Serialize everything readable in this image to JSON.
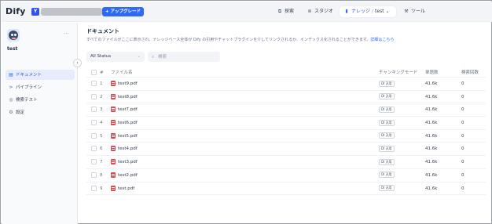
{
  "header": {
    "logo": "Dify",
    "workspace_initial": "Y",
    "upgrade_label": "+ アップグレード",
    "nav": {
      "explore": "探索",
      "studio": "スタジオ",
      "knowledge": "ナレッジ",
      "dataset_name": "test",
      "tools": "ツール"
    }
  },
  "sidebar": {
    "dataset_title": "test",
    "more": "···",
    "collapse": "‹",
    "items": [
      {
        "label": "ドキュメント",
        "icon": "document-icon",
        "active": true
      },
      {
        "label": "パイプライン",
        "icon": "pipeline-icon",
        "active": false
      },
      {
        "label": "検索テスト",
        "icon": "target-icon",
        "active": false
      },
      {
        "label": "設定",
        "icon": "settings-icon",
        "active": false
      }
    ]
  },
  "main": {
    "title": "ドキュメント",
    "description": "すべてのファイルがここに表示され、ナレッジベース全体が Dify の引用やチャットプラグインを介してリンクされるか、インデックス化されることができます。",
    "description_link": "詳細はこちら",
    "status_select": "All Status",
    "search_placeholder": "検索",
    "columns": {
      "num": "#",
      "name": "ファイル名",
      "mode": "チャンキングモード",
      "words": "単語数",
      "hits": "検索回数"
    },
    "rows": [
      {
        "num": "1",
        "name": "test9.pdf",
        "mode": "DI 汎用",
        "words": "41.6k",
        "hits": "0"
      },
      {
        "num": "2",
        "name": "test8.pdf",
        "mode": "DI 汎用",
        "words": "41.6k",
        "hits": "0"
      },
      {
        "num": "3",
        "name": "test7.pdf",
        "mode": "DI 汎用",
        "words": "41.6k",
        "hits": "0"
      },
      {
        "num": "4",
        "name": "test6.pdf",
        "mode": "DI 汎用",
        "words": "41.6k",
        "hits": "0"
      },
      {
        "num": "5",
        "name": "test5.pdf",
        "mode": "DI 汎用",
        "words": "41.6k",
        "hits": "0"
      },
      {
        "num": "6",
        "name": "test4.pdf",
        "mode": "DI 汎用",
        "words": "41.6k",
        "hits": "0"
      },
      {
        "num": "7",
        "name": "test3.pdf",
        "mode": "DI 汎用",
        "words": "41.6k",
        "hits": "0"
      },
      {
        "num": "8",
        "name": "test2.pdf",
        "mode": "DI 汎用",
        "words": "41.6k",
        "hits": "0"
      },
      {
        "num": "9",
        "name": "test.pdf",
        "mode": "DI 汎用",
        "words": "41.6k",
        "hits": "0"
      }
    ]
  },
  "colors": {
    "accent": "#2f6bf2",
    "pdf": "#e5484d",
    "sidebar_active_bg": "#e6ecfb"
  }
}
